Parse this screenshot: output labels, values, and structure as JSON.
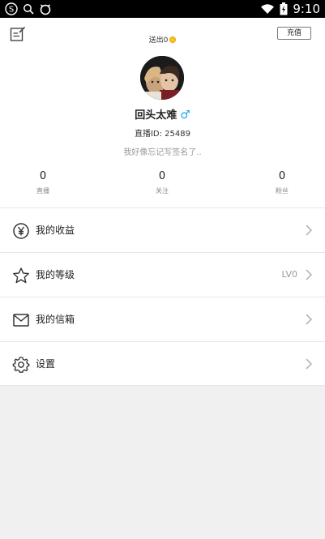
{
  "status_bar": {
    "time": "9:10",
    "icons": [
      "sogou-icon",
      "search-icon",
      "app-icon",
      "wifi-icon",
      "battery-icon"
    ]
  },
  "profile": {
    "coins_label": "送出0",
    "recharge_label": "充值",
    "username": "回头太难",
    "gender_symbol": "♂",
    "live_id": "直播ID: 25489",
    "signature": "我好像忘记写签名了.."
  },
  "stats": [
    {
      "value": "0",
      "label": "直播"
    },
    {
      "value": "0",
      "label": "关注"
    },
    {
      "value": "0",
      "label": "粉丝"
    }
  ],
  "menu": [
    {
      "label": "我的收益",
      "value": "",
      "icon": "income-icon"
    },
    {
      "label": "我的等级",
      "value": "LV0",
      "icon": "star-icon"
    },
    {
      "label": "我的信箱",
      "value": "",
      "icon": "mail-icon"
    },
    {
      "label": "设置",
      "value": "",
      "icon": "settings-icon"
    }
  ],
  "colors": {
    "gender": "#1aa6e6",
    "coin": "#f3c623",
    "background": "#f0f0f0"
  }
}
